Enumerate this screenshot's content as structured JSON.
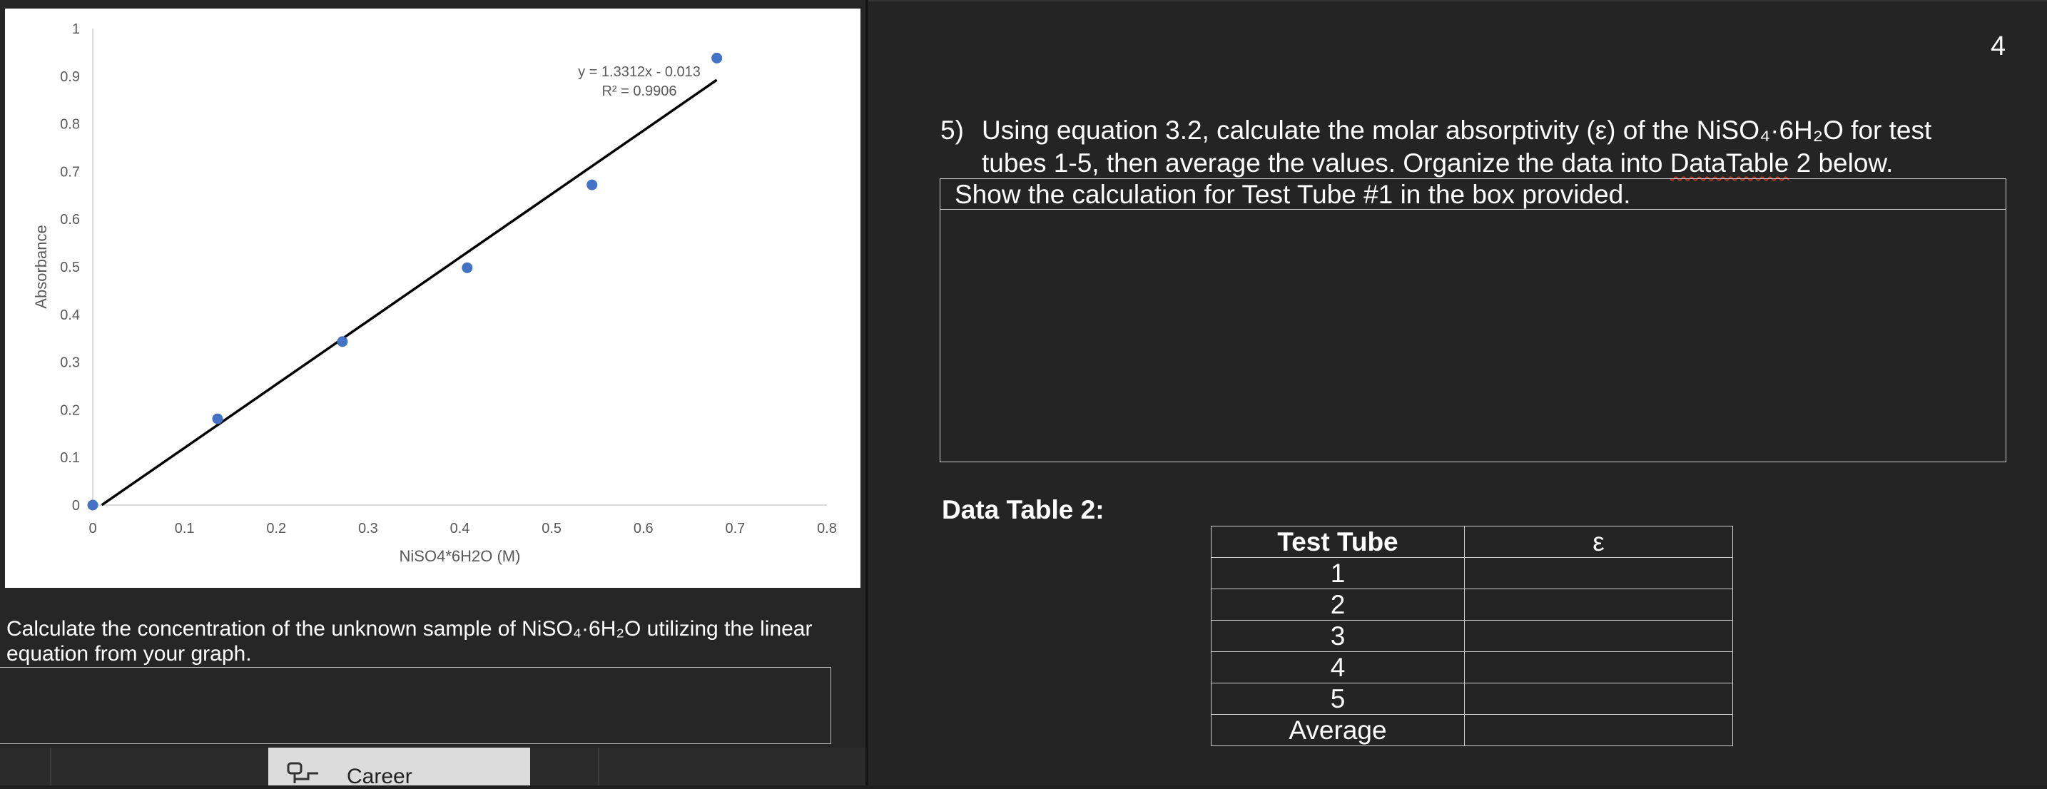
{
  "chart_data": {
    "type": "scatter",
    "xlabel": "NiSO4*6H2O (M)",
    "ylabel": "Absorbance",
    "xlim": [
      0,
      0.8
    ],
    "ylim": [
      0,
      1
    ],
    "x_ticks": [
      "0",
      "0.1",
      "0.2",
      "0.3",
      "0.4",
      "0.5",
      "0.6",
      "0.7",
      "0.8"
    ],
    "y_ticks": [
      "0",
      "0.1",
      "0.2",
      "0.3",
      "0.4",
      "0.5",
      "0.6",
      "0.7",
      "0.8",
      "0.9",
      "1"
    ],
    "points": [
      {
        "x": 0.0,
        "y": 0.0
      },
      {
        "x": 0.136,
        "y": 0.181
      },
      {
        "x": 0.272,
        "y": 0.343
      },
      {
        "x": 0.408,
        "y": 0.498
      },
      {
        "x": 0.544,
        "y": 0.672
      },
      {
        "x": 0.68,
        "y": 0.938
      }
    ],
    "trendline": {
      "slope": 1.3312,
      "intercept": -0.013,
      "x_range": [
        0.0098,
        0.68
      ]
    },
    "annotation_equation": "y = 1.3312x - 0.013",
    "annotation_r2": "R² = 0.9906",
    "colors": {
      "points": "#4472c4",
      "trendline": "#000000",
      "gridline": "#d9d9d9",
      "text": "#595959"
    }
  },
  "left": {
    "question_line1": "Calculate the concentration of the unknown sample of NiSO₄·6H₂O utilizing the linear",
    "question_line2": "equation from your graph."
  },
  "taskbar": {
    "career_label": "Career",
    "career_icon": "career-icon"
  },
  "right": {
    "page_number": "4",
    "q5_number": "5)",
    "q5_line1": "Using equation 3.2, calculate the molar absorptivity (ε) of the NiSO₄·6H₂O for test",
    "q5_line2_a": "tubes 1-5, then average the values.  Organize the data into ",
    "q5_line2_b": "DataTable",
    "q5_line2_c": " 2 below.",
    "show_label": "Show the calculation for Test Tube #1 in the box provided.",
    "data_table_label": "Data Table 2:",
    "table_headers": [
      "Test Tube",
      "ε"
    ],
    "table_rows": [
      "1",
      "2",
      "3",
      "4",
      "5",
      "Average"
    ]
  }
}
